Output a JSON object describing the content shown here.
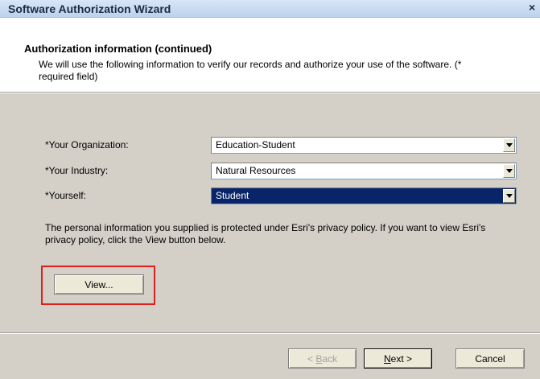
{
  "window": {
    "title": "Software Authorization Wizard",
    "close_glyph": "×"
  },
  "header": {
    "title": "Authorization information (continued)",
    "description": "We will use the following information to verify our records and authorize your use of the software. (* required field)"
  },
  "form": {
    "organization": {
      "label": "*Your Organization:",
      "value": "Education-Student"
    },
    "industry": {
      "label": "*Your Industry:",
      "value": "Natural Resources"
    },
    "yourself": {
      "label": "*Yourself:",
      "value": "Student"
    }
  },
  "privacy_text": "The personal information you supplied is protected under Esri's privacy policy. If you want to view Esri's privacy policy, click the View button below.",
  "buttons": {
    "view": "View...",
    "back_prefix": "< ",
    "back_mnemonic": "B",
    "back_rest": "ack",
    "next_mnemonic": "N",
    "next_rest": "ext >",
    "cancel": "Cancel"
  },
  "colors": {
    "highlight": "#e0211b",
    "selection": "#0a246a",
    "dialog_bg": "#d4d0c8"
  }
}
